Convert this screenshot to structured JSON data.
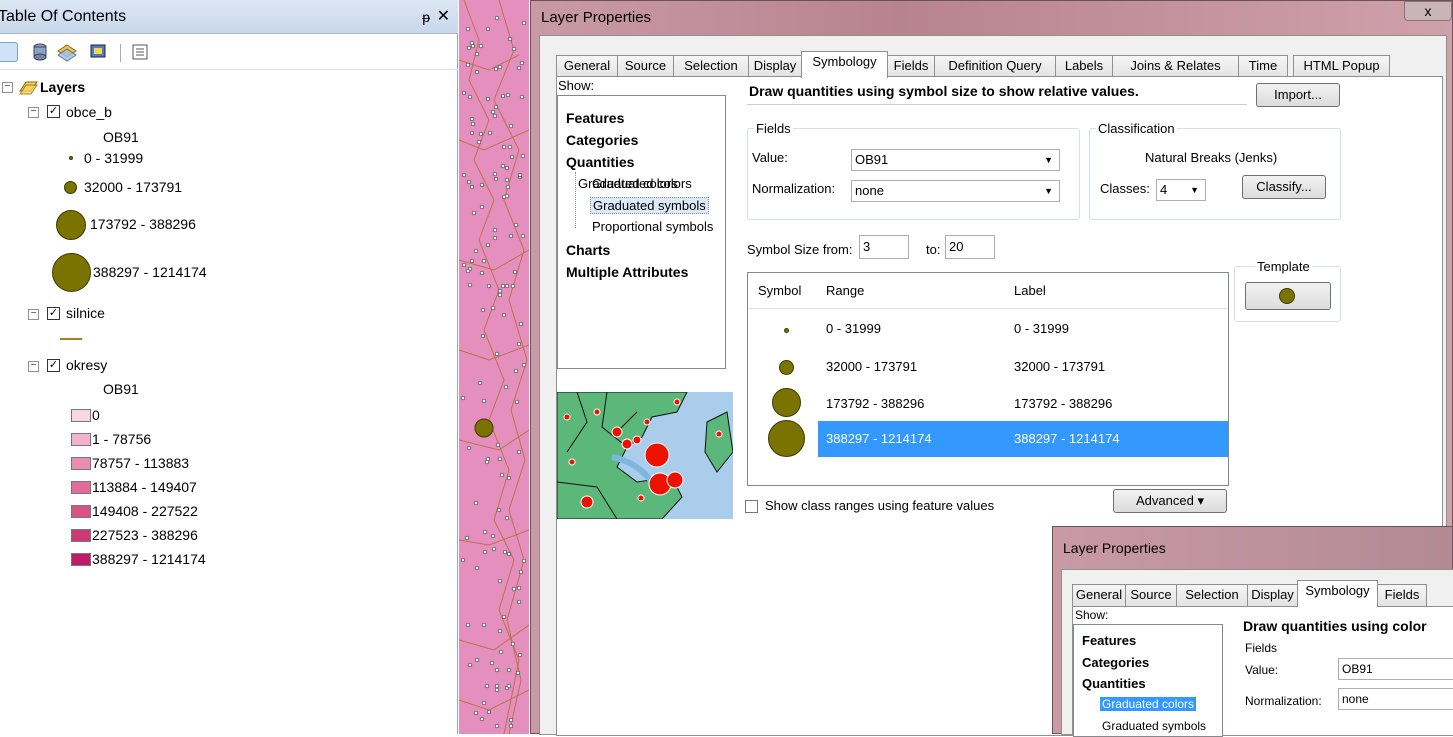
{
  "toc": {
    "title": "Table Of Contents",
    "pin_glyph": "ᵽ",
    "close_glyph": "✕",
    "layers_root": "Layers",
    "layers": [
      {
        "name": "obce_b",
        "checked": true,
        "field": "OB91",
        "classes": [
          "0 - 31999",
          "32000 - 173791",
          "173792 - 388296",
          "388297 - 1214174"
        ]
      },
      {
        "name": "silnice",
        "checked": true
      },
      {
        "name": "okresy",
        "checked": true,
        "field": "OB91",
        "classes": [
          "0",
          "1 - 78756",
          "78757 - 113883",
          "113884 - 149407",
          "149408 - 227522",
          "227523 - 388296",
          "388297 - 1214174"
        ],
        "colors": [
          "#f9d6e4",
          "#f4b3cb",
          "#eb8db0",
          "#e06c9a",
          "#d75287",
          "#cc3a76",
          "#c0196a"
        ]
      }
    ]
  },
  "dialog": {
    "title": "Layer Properties",
    "close_glyph": "x",
    "tabs": [
      "General",
      "Source",
      "Selection",
      "Display",
      "Symbology",
      "Fields",
      "Definition Query",
      "Labels",
      "Joins & Relates",
      "Time",
      "HTML Popup"
    ],
    "selected_tab": "Symbology",
    "show_label": "Show:",
    "show_items": [
      "Features",
      "Categories",
      "Quantities",
      "Graduated colors",
      "Graduated symbols",
      "Proportional symbols",
      "Charts",
      "Multiple Attributes"
    ],
    "selected_show": "Graduated symbols",
    "heading": "Draw quantities using symbol size to show relative values.",
    "import_label": "Import...",
    "fields_group": "Fields",
    "value_label": "Value:",
    "value": "OB91",
    "normalization_label": "Normalization:",
    "normalization": "none",
    "classification_group": "Classification",
    "classification_method": "Natural Breaks (Jenks)",
    "classes_label": "Classes:",
    "classes_value": "4",
    "classify_label": "Classify...",
    "symbol_size_from_label": "Symbol Size from:",
    "symbol_size_from": "3",
    "to_label": "to:",
    "symbol_size_to": "20",
    "template_label": "Template",
    "table_headers": [
      "Symbol",
      "Range",
      "Label"
    ],
    "rows": [
      {
        "range": "0 - 31999",
        "label": "0 - 31999"
      },
      {
        "range": "32000 - 173791",
        "label": "32000 - 173791"
      },
      {
        "range": "173792 - 388296",
        "label": "173792 - 388296"
      },
      {
        "range": "388297 - 1214174",
        "label": "388297 - 1214174"
      }
    ],
    "selected_row": 3,
    "show_ranges_label": "Show class ranges using feature values",
    "advanced_label": "Advanced"
  },
  "dialog2": {
    "title": "Layer Properties",
    "tabs": [
      "General",
      "Source",
      "Selection",
      "Display",
      "Symbology",
      "Fields"
    ],
    "selected_tab": "Symbology",
    "show_label": "Show:",
    "show_items": [
      "Features",
      "Categories",
      "Quantities",
      "Graduated colors",
      "Graduated symbols"
    ],
    "selected_show": "Graduated colors",
    "heading": "Draw quantities using color",
    "fields_group": "Fields",
    "value_label": "Value:",
    "value": "OB91",
    "normalization_label": "Normalization:",
    "normalization": "none"
  },
  "colors": {
    "symbol_fill": "#7a7300",
    "selection": "#3399ff",
    "map_bg": "#e58fbf"
  }
}
